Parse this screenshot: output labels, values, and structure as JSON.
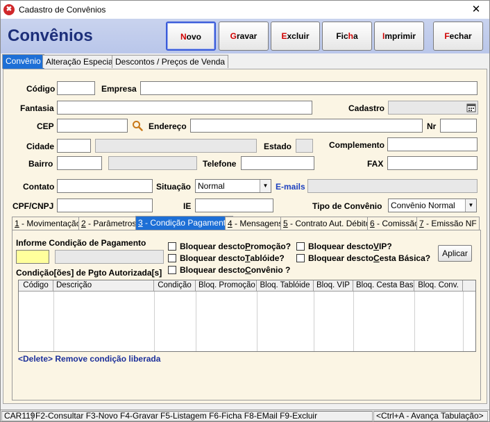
{
  "window": {
    "title": "Cadastro de Convênios",
    "close_glyph": "✕",
    "app_icon": "✖"
  },
  "header": {
    "title": "Convênios"
  },
  "toolbar": [
    {
      "pre": "",
      "hot": "N",
      "post": "ovo"
    },
    {
      "pre": "",
      "hot": "G",
      "post": "ravar"
    },
    {
      "pre": "",
      "hot": "E",
      "post": "xcluir"
    },
    {
      "pre": "Fic",
      "hot": "h",
      "post": "a"
    },
    {
      "pre": "",
      "hot": "I",
      "post": "mprimir"
    },
    {
      "pre": "",
      "hot": "F",
      "post": "echar"
    }
  ],
  "tabs": [
    "Convênio",
    "Alteração Especial",
    "Descontos / Preços de Venda"
  ],
  "form": {
    "codigo": {
      "label": "Código",
      "value": ""
    },
    "empresa": {
      "label": "Empresa",
      "value": ""
    },
    "fantasia": {
      "label": "Fantasia",
      "value": ""
    },
    "cadastro": {
      "label": "Cadastro",
      "value": ""
    },
    "cep": {
      "label": "CEP",
      "value": ""
    },
    "endereco": {
      "label": "Endereço",
      "value": ""
    },
    "nr": {
      "label": "Nr",
      "value": ""
    },
    "cidade": {
      "label": "Cidade",
      "value": ""
    },
    "estado": {
      "label": "Estado",
      "value": ""
    },
    "complemento": {
      "label": "Complemento",
      "value": ""
    },
    "bairro": {
      "label": "Bairro",
      "value": ""
    },
    "telefone": {
      "label": "Telefone",
      "value": ""
    },
    "fax": {
      "label": "FAX",
      "value": ""
    },
    "contato": {
      "label": "Contato",
      "value": ""
    },
    "situacao": {
      "label": "Situação",
      "value": "Normal"
    },
    "emails": {
      "label": "E-mails",
      "value": ""
    },
    "cpf": {
      "label": "CPF/CNPJ",
      "value": ""
    },
    "ie": {
      "label": "IE",
      "value": ""
    },
    "tipo": {
      "label": "Tipo de Convênio",
      "value": "Convênio Normal"
    }
  },
  "subtabs": [
    {
      "hot": "1",
      "rest": " - Movimentação"
    },
    {
      "hot": "2",
      "rest": " - Parâmetros"
    },
    {
      "hot": "3",
      "rest": " - Condição Pagamento"
    },
    {
      "hot": "4",
      "rest": " - Mensagens"
    },
    {
      "hot": "5",
      "rest": " - Contrato Aut. Débito"
    },
    {
      "hot": "6",
      "rest": " - Comissão"
    },
    {
      "hot": "7",
      "rest": " - Emissão NF"
    }
  ],
  "condicao": {
    "informe_label": "Informe Condição de Pagamento",
    "code_value": "",
    "desc_value": "",
    "checks": [
      {
        "pre": "Bloquear descto ",
        "hot": "P",
        "post": "romoção?"
      },
      {
        "pre": "Bloquear descto ",
        "hot": "V",
        "post": "IP?"
      },
      {
        "pre": "Bloquear descto ",
        "hot": "T",
        "post": "ablóide?"
      },
      {
        "pre": "Bloquear descto ",
        "hot": "C",
        "post": "esta Básica?"
      },
      {
        "pre": "Bloquear descto ",
        "hot": "C",
        "post": "onvênio ?"
      }
    ],
    "apply_label": "Aplicar",
    "authorized_label": "Condição[ões] de Pgto Autorizada[s]",
    "columns": [
      "Código",
      "Descrição",
      "Condição",
      "Bloq. Promoção",
      "Bloq. Tablóide",
      "Bloq. VIP",
      "Bloq. Cesta Bas.",
      "Bloq. Conv."
    ],
    "hint": "<Delete> Remove condição liberada"
  },
  "statusbar": {
    "code": "CAR119",
    "shortcuts": "F2-Consultar  F3-Novo  F4-Gravar  F5-Listagem  F6-Ficha  F8-EMail  F9-Excluir",
    "right": "<Ctrl+A - Avança Tabulação>"
  }
}
